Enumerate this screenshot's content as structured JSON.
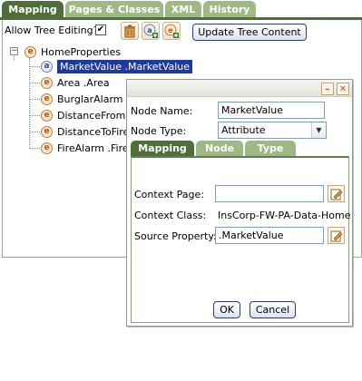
{
  "top_tabs": [
    {
      "label": "Mapping",
      "active": true
    },
    {
      "label": "Pages & Classes",
      "active": false
    },
    {
      "label": "XML",
      "active": false
    },
    {
      "label": "History",
      "active": false
    }
  ],
  "toolbar": {
    "allow_editing_label": "Allow Tree Editing?",
    "allow_editing_checked": "✔",
    "delete_icon": "trash-icon",
    "add_attribute_icon": "add-attribute-icon",
    "add_element_icon": "add-element-icon",
    "update_button": "Update Tree Content"
  },
  "tree": {
    "root": {
      "label": "HomeProperties",
      "icon": "e",
      "expander": "−"
    },
    "children": [
      {
        "label": "MarketValue .MarketValue",
        "icon": "a"
      },
      {
        "label": "Area .Area",
        "icon": "e"
      },
      {
        "label": "BurglarAlarm .B",
        "icon": "e"
      },
      {
        "label": "DistanceFromFi",
        "icon": "e"
      },
      {
        "label": "DistanceToFireS",
        "icon": "e"
      },
      {
        "label": "FireAlarm .FireA",
        "icon": "e"
      }
    ]
  },
  "dialog": {
    "minimize_glyph": "–",
    "close_glyph": "✕",
    "node_name_label": "Node Name:",
    "node_name_value": "MarketValue",
    "node_type_label": "Node Type:",
    "node_type_value": "Attribute",
    "tabs": [
      {
        "label": "Mapping",
        "active": true
      },
      {
        "label": "Node",
        "active": false
      },
      {
        "label": "Type",
        "active": false
      }
    ],
    "context_page_label": "Context Page:",
    "context_page_value": "",
    "context_class_label": "Context Class:",
    "context_class_value": "InsCorp-FW-PA-Data-Home",
    "source_property_label": "Source Property:",
    "source_property_value": ".MarketValue",
    "ok_button": "OK",
    "cancel_button": "Cancel"
  },
  "colors": {
    "tab_active": "#4f6f3a",
    "tab_inactive": "#9dba84",
    "selection": "#1e3a9a",
    "button_border": "#2a3d7a"
  }
}
